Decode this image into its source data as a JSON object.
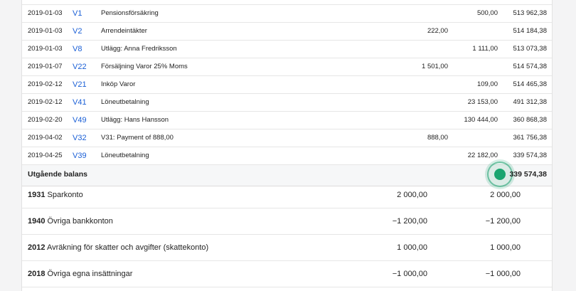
{
  "transactions": [
    {
      "date": "2019-01-03",
      "voucher": "V1",
      "description": "Pensionsförsäkring",
      "debit": "",
      "credit": "500,00",
      "balance": "513 962,38"
    },
    {
      "date": "2019-01-03",
      "voucher": "V2",
      "description": "Arrendeintäkter",
      "debit": "222,00",
      "credit": "",
      "balance": "514 184,38"
    },
    {
      "date": "2019-01-03",
      "voucher": "V8",
      "description": "Utlägg: Anna Fredriksson",
      "debit": "",
      "credit": "1 111,00",
      "balance": "513 073,38"
    },
    {
      "date": "2019-01-07",
      "voucher": "V22",
      "description": "Försäljning Varor 25% Moms",
      "debit": "1 501,00",
      "credit": "",
      "balance": "514 574,38"
    },
    {
      "date": "2019-02-12",
      "voucher": "V21",
      "description": "Inköp Varor",
      "debit": "",
      "credit": "109,00",
      "balance": "514 465,38"
    },
    {
      "date": "2019-02-12",
      "voucher": "V41",
      "description": "Löneutbetalning",
      "debit": "",
      "credit": "23 153,00",
      "balance": "491 312,38"
    },
    {
      "date": "2019-02-20",
      "voucher": "V49",
      "description": "Utlägg: Hans Hansson",
      "debit": "",
      "credit": "130 444,00",
      "balance": "360 868,38"
    },
    {
      "date": "2019-04-02",
      "voucher": "V32",
      "description": "V31: Payment of 888,00",
      "debit": "888,00",
      "credit": "",
      "balance": "361 756,38"
    },
    {
      "date": "2019-04-25",
      "voucher": "V39",
      "description": "Löneutbetalning",
      "debit": "",
      "credit": "22 182,00",
      "balance": "339 574,38"
    }
  ],
  "closing": {
    "label": "Utgående balans",
    "value": "339 574,38"
  },
  "accounts": [
    {
      "number": "1931",
      "name": "Sparkonto",
      "value1": "2 000,00",
      "value2": "2 000,00"
    },
    {
      "number": "1940",
      "name": "Övriga bankkonton",
      "value1": "−1 200,00",
      "value2": "−1 200,00"
    },
    {
      "number": "2012",
      "name": "Avräkning för skatter och avgifter (skattekonto)",
      "value1": "1 000,00",
      "value2": "1 000,00"
    },
    {
      "number": "2018",
      "name": "Övriga egna insättningar",
      "value1": "−1 000,00",
      "value2": "−1 000,00"
    }
  ]
}
